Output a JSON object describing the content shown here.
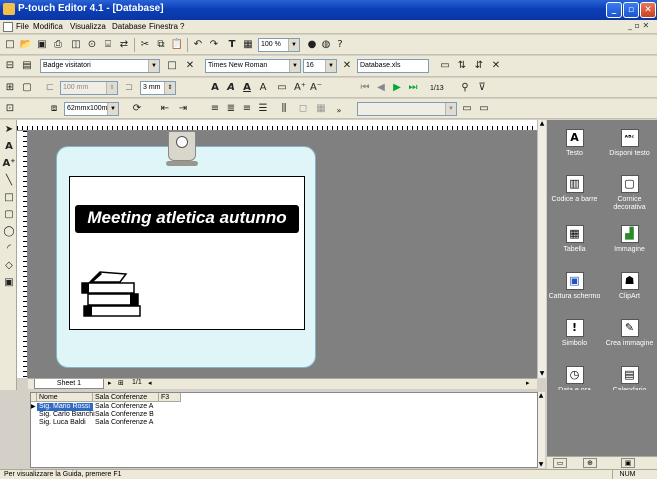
{
  "window": {
    "title": "P-touch Editor 4.1 - [Database]"
  },
  "menu": [
    "File",
    "Modifica",
    "Visualizza",
    "Database",
    "Finestra",
    "?"
  ],
  "toolbar": {
    "template_name": "Badge visitatori",
    "font_name": "Times New Roman",
    "font_size": "16",
    "database_file": "Database.xls",
    "tape_width": "100 mm",
    "margin": "3 mm",
    "media_size": "62mmx100mm",
    "zoom": "100 %",
    "record_counter": "1/13"
  },
  "label": {
    "title": "Meeting atletica autunno"
  },
  "sheet_tabs": {
    "sheet_name": "Sheet 1",
    "page_counter": "1/1"
  },
  "database": {
    "columns": [
      "Nome",
      "Sala Conferenze",
      "F3"
    ],
    "rows": [
      {
        "nome": "Sig. Mario Rossi",
        "sala": "Sala Conferenze A",
        "selected": true
      },
      {
        "nome": "Sig. Carlo Bianchi",
        "sala": "Sala Conferenze B",
        "selected": false
      },
      {
        "nome": "Sig. Luca Baldi",
        "sala": "Sala Conferenze A",
        "selected": false
      }
    ]
  },
  "object_tools": [
    {
      "label": "Testo",
      "icon": "text-icon"
    },
    {
      "label": "Disponi testo",
      "icon": "arrange-text-icon"
    },
    {
      "label": "Codice a barre",
      "icon": "barcode-icon"
    },
    {
      "label": "Cornice decorativa",
      "icon": "frame-icon"
    },
    {
      "label": "Tabella",
      "icon": "table-icon"
    },
    {
      "label": "Immagine",
      "icon": "image-icon"
    },
    {
      "label": "Cattura schermo",
      "icon": "screen-capture-icon"
    },
    {
      "label": "ClipArt",
      "icon": "clipart-icon"
    },
    {
      "label": "Simbolo",
      "icon": "symbol-icon"
    },
    {
      "label": "Crea immagine",
      "icon": "create-image-icon"
    },
    {
      "label": "Data e ora",
      "icon": "date-time-icon"
    },
    {
      "label": "Calendario",
      "icon": "calendar-icon"
    }
  ],
  "status": {
    "help_text": "Per visualizzare la Guida, premere F1",
    "num": "NUM"
  },
  "colors": {
    "title_bar": "#0b3fb7",
    "workspace": "#808080",
    "label_title_bg": "#000000",
    "selection": "#316ac5"
  }
}
